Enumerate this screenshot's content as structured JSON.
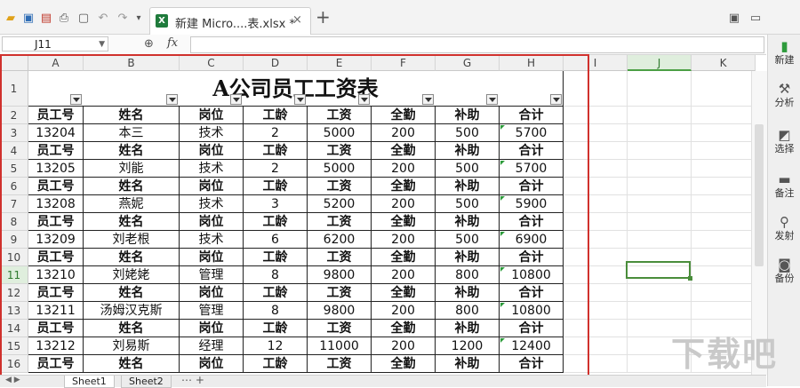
{
  "tab": {
    "file_name": "新建 Micro....表.xlsx *",
    "close": "×",
    "new_tab": "+"
  },
  "formula_bar": {
    "name_box": "J11",
    "fx": "fx",
    "value": ""
  },
  "sidebar": {
    "items": [
      {
        "icon": "new-icon",
        "label": "新建"
      },
      {
        "icon": "analyze-icon",
        "label": "分析"
      },
      {
        "icon": "select-icon",
        "label": "选择"
      },
      {
        "icon": "note-icon",
        "label": "备注"
      },
      {
        "icon": "send-icon",
        "label": "发射"
      },
      {
        "icon": "backup-icon",
        "label": "备份"
      }
    ]
  },
  "columns": [
    "A",
    "B",
    "C",
    "D",
    "E",
    "F",
    "G",
    "H",
    "I",
    "J",
    "K"
  ],
  "rows": [
    "1",
    "2",
    "3",
    "4",
    "5",
    "6",
    "7",
    "8",
    "9",
    "10",
    "11",
    "12",
    "13",
    "14",
    "15",
    "16"
  ],
  "active_cell": "J11",
  "sheet": {
    "title": "A公司员工工资表",
    "header": [
      "员工号",
      "姓名",
      "岗位",
      "工龄",
      "工资",
      "全勤",
      "补助",
      "合计"
    ],
    "records": [
      [
        "13204",
        "本三",
        "技术",
        "2",
        "5000",
        "200",
        "500",
        "5700"
      ],
      [
        "13205",
        "刘能",
        "技术",
        "2",
        "5000",
        "200",
        "500",
        "5700"
      ],
      [
        "13208",
        "燕妮",
        "技术",
        "3",
        "5200",
        "200",
        "500",
        "5900"
      ],
      [
        "13209",
        "刘老根",
        "技术",
        "6",
        "6200",
        "200",
        "500",
        "6900"
      ],
      [
        "13210",
        "刘姥姥",
        "管理",
        "8",
        "9800",
        "200",
        "800",
        "10800"
      ],
      [
        "13211",
        "汤姆汉克斯",
        "管理",
        "8",
        "9800",
        "200",
        "800",
        "10800"
      ],
      [
        "13212",
        "刘易斯",
        "经理",
        "12",
        "11000",
        "200",
        "1200",
        "12400"
      ]
    ]
  },
  "sheet_tabs": [
    "Sheet1",
    "Sheet2"
  ],
  "watermark": "下载吧",
  "colors": {
    "frame": "#d0312d",
    "accent": "#4a8d3b",
    "excel": "#1f7b3c"
  }
}
